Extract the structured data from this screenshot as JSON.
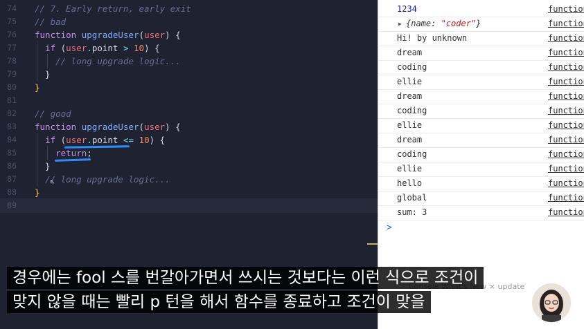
{
  "editor": {
    "lines": [
      {
        "num": "74",
        "parts": [
          [
            "c",
            "// 7. Early return, early exit"
          ]
        ]
      },
      {
        "num": "75",
        "parts": [
          [
            "c",
            "// bad"
          ]
        ]
      },
      {
        "num": "76",
        "parts": [
          [
            "k",
            "function "
          ],
          [
            "f",
            "upgradeUser"
          ],
          [
            "t",
            "("
          ],
          [
            "p",
            "user"
          ],
          [
            "t",
            ") {"
          ]
        ]
      },
      {
        "num": "77",
        "parts": [
          [
            "t",
            "  "
          ],
          [
            "k",
            "if "
          ],
          [
            "t",
            "("
          ],
          [
            "p",
            "user"
          ],
          [
            "o",
            "."
          ],
          [
            "t",
            "point "
          ],
          [
            "o",
            "> "
          ],
          [
            "n",
            "10"
          ],
          [
            "t",
            ") {"
          ]
        ]
      },
      {
        "num": "78",
        "parts": [
          [
            "t",
            "    "
          ],
          [
            "c",
            "// long upgrade logic..."
          ]
        ]
      },
      {
        "num": "79",
        "parts": [
          [
            "t",
            "  }"
          ]
        ]
      },
      {
        "num": "80",
        "parts": [
          [
            "y",
            "}"
          ]
        ]
      },
      {
        "num": "81",
        "parts": []
      },
      {
        "num": "82",
        "parts": [
          [
            "c",
            "// good"
          ]
        ]
      },
      {
        "num": "83",
        "parts": [
          [
            "k",
            "function "
          ],
          [
            "f",
            "upgradeUser"
          ],
          [
            "t",
            "("
          ],
          [
            "p",
            "user"
          ],
          [
            "t",
            ") {"
          ]
        ]
      },
      {
        "num": "84",
        "parts": [
          [
            "t",
            "  "
          ],
          [
            "k",
            "if "
          ],
          [
            "t",
            "("
          ],
          [
            "p",
            "user"
          ],
          [
            "o",
            "."
          ],
          [
            "t",
            "point "
          ],
          [
            "o",
            "<= "
          ],
          [
            "n",
            "10"
          ],
          [
            "t",
            ") {"
          ]
        ]
      },
      {
        "num": "85",
        "parts": [
          [
            "t",
            "    "
          ],
          [
            "k",
            "return"
          ],
          [
            "t",
            ";"
          ]
        ]
      },
      {
        "num": "86",
        "parts": [
          [
            "t",
            "  }"
          ]
        ]
      },
      {
        "num": "87",
        "parts": [
          [
            "t",
            "  "
          ],
          [
            "c",
            "// long upgrade logic..."
          ]
        ]
      },
      {
        "num": "88",
        "parts": [
          [
            "y",
            "}"
          ]
        ]
      },
      {
        "num": "89",
        "parts": []
      }
    ]
  },
  "console": {
    "rows": [
      {
        "value": "1234",
        "kind": "num",
        "source": "function"
      },
      {
        "value": "",
        "kind": "obj",
        "obj_prefix": "{name: ",
        "obj_str": "\"coder\"",
        "obj_suffix": "}",
        "source": "function"
      },
      {
        "value": "Hi! by unknown",
        "kind": "text",
        "source": "function"
      },
      {
        "value": "dream",
        "kind": "text",
        "source": "function"
      },
      {
        "value": "coding",
        "kind": "text",
        "source": "function"
      },
      {
        "value": "ellie",
        "kind": "text",
        "source": "function"
      },
      {
        "value": "dream",
        "kind": "text",
        "source": "function"
      },
      {
        "value": "coding",
        "kind": "text",
        "source": "function"
      },
      {
        "value": "ellie",
        "kind": "text",
        "source": "function"
      },
      {
        "value": "dream",
        "kind": "text",
        "source": "function"
      },
      {
        "value": "coding",
        "kind": "text",
        "source": "function"
      },
      {
        "value": "ellie",
        "kind": "text",
        "source": "function"
      },
      {
        "value": "hello",
        "kind": "text",
        "source": "function"
      },
      {
        "value": "global",
        "kind": "text",
        "source": "function"
      },
      {
        "value": "sum: 3",
        "kind": "text",
        "source": "function"
      }
    ],
    "prompt": ">",
    "drawer_hint": "Console   What's New   ×      update"
  },
  "subtitles": {
    "line1": "경우에는 fool 스를 번갈아가면서 쓰시는 것보다는 이런 식으로 조건이",
    "line2": "맞지 않을 때는 빨리 p 턴을 해서 함수를 종료하고 조건이 맞을"
  },
  "colors": {
    "editor_bg": "#1f2231",
    "underline_accent": "#2f8cff",
    "console_bg": "#ffffff"
  },
  "icons": [
    "expand-triangle-icon",
    "mouse-cursor-icon",
    "presenter-avatar"
  ]
}
